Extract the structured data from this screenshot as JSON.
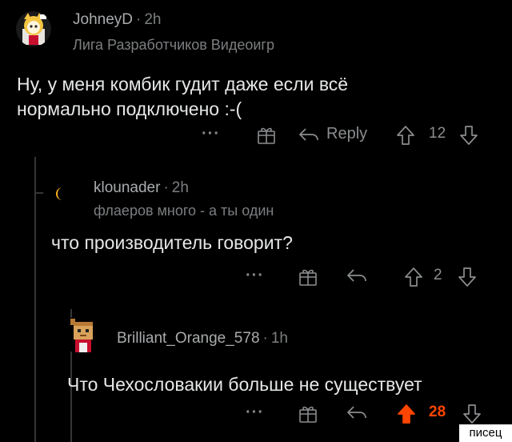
{
  "comments": [
    {
      "username": "JohneyD",
      "separator": "·",
      "time": "2h",
      "flair": "Лига Разработчиков Видеоигр",
      "body_lines": [
        "Ну, у меня комбик гудит даже если всё",
        "нормально подключено :-("
      ],
      "actions": {
        "more": "···",
        "reply": "Reply",
        "score": "12"
      }
    },
    {
      "username": "klounader",
      "separator": "·",
      "time": "2h",
      "flair": "флаеров много - а ты один",
      "body_lines": [
        "что производитель говорит?"
      ],
      "actions": {
        "more": "···",
        "score": "2"
      }
    },
    {
      "username": "Brilliant_Orange_578",
      "separator": "·",
      "time": "1h",
      "body_lines": [
        "Что Чехословакии больше не существует"
      ],
      "actions": {
        "more": "···",
        "score": "28"
      }
    }
  ],
  "colors": {
    "background": "#000000",
    "upvoted": "#ff4500",
    "muted": "#8b8d8f"
  },
  "icons": [
    "award-icon",
    "reply-arrow-icon",
    "upvote-icon",
    "downvote-icon",
    "more-icon"
  ],
  "watermark": "писец"
}
